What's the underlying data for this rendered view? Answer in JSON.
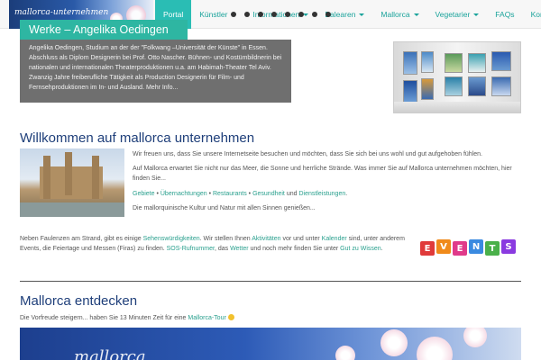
{
  "header": {
    "logo_text": "mallorca-unternehmen",
    "nav": [
      {
        "label": "Portal",
        "active": true,
        "caret": false
      },
      {
        "label": "Künstler",
        "active": false,
        "caret": true
      },
      {
        "label": "Informationen",
        "active": false,
        "caret": true
      },
      {
        "label": "Balearen",
        "active": false,
        "caret": true
      },
      {
        "label": "Mallorca",
        "active": false,
        "caret": true
      },
      {
        "label": "Vegetarier",
        "active": false,
        "caret": true
      },
      {
        "label": "FAQs",
        "active": false,
        "caret": false
      },
      {
        "label": "Kontakt",
        "active": false,
        "caret": true
      }
    ]
  },
  "hero": {
    "title": "Werke – Angelika Oedingen",
    "text": "Angelika Oedingen, Studium an der der \"Folkwang –Universität der Künste\" in Essen. Abschluss als Diplom Designerin bei Prof. Otto Nascher. Bühnen- und Kostümbildnerin bei nationalen und internationalen Theaterproduktionen u.a. am Habimah-Theater Tel Aviv. Zwanzig Jahre freiberufliche Tätigkeit als Production Designerin für Film- und Fernsehproduktionen im In- und Ausland. Mehr Info..."
  },
  "welcome": {
    "heading": "Willkommen auf  mallorca unternehmen",
    "p1": "Wir freuen uns, dass Sie unsere Internetseite besuchen und möchten, dass Sie sich bei uns wohl und gut aufgehoben fühlen.",
    "p2": "Auf Mallorca erwartet Sie nicht nur das Meer, die Sonne und herrliche Strände. Was immer Sie auf Mallorca unternehmen möchten, hier finden Sie...",
    "links": {
      "gebiete": "Gebiete",
      "sep1": " • ",
      "uebernachtungen": "Übernachtungen",
      "sep2": " • ",
      "restaurants": "Restaurants",
      "sep3": " • ",
      "gesundheit": "Gesundheit",
      "und": " und ",
      "dienstleistungen": "Dienstleistungen",
      "end": "."
    },
    "p3": "Die mallorquinische Kultur und Natur mit allen Sinnen genießen...",
    "events_text": {
      "t1": "Neben Faulenzen am Strand, gibt es einige ",
      "l1": "Sehenswürdigkeiten",
      "t2": ". Wir stellen Ihnen ",
      "l2": "Aktivitäten",
      "t3": " vor und unter ",
      "l3": "Kalender",
      "t4": " sind, unter anderem Events, die Feiertage und Messen (Firas) zu finden. ",
      "l4": "SOS-Rufnummer",
      "t5": ", das ",
      "l5": "Wetter",
      "t6": " und noch mehr finden Sie unter ",
      "l6": "Gut zu Wissen",
      "t7": "."
    },
    "events_letters": [
      "E",
      "V",
      "E",
      "N",
      "T",
      "S"
    ]
  },
  "discover": {
    "heading": "Mallorca entdecken",
    "t1": "Die Vorfreude steigern... haben Sie 13 Minuten Zeit für eine ",
    "link": "Mallorca-Tour",
    "banner_text": "mallorca"
  },
  "colors": {
    "accent": "#2abdb4",
    "link": "#2aa08e",
    "heading": "#1f3f7a"
  }
}
